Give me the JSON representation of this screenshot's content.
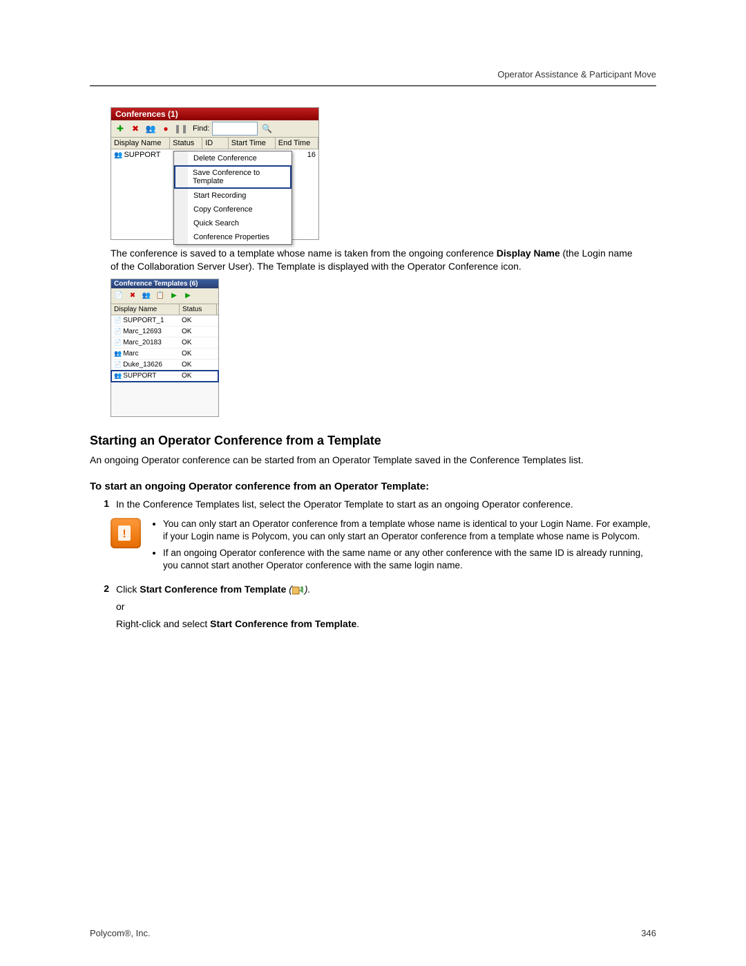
{
  "header": {
    "right": "Operator Assistance & Participant Move"
  },
  "conferences_panel": {
    "title": "Conferences (1)",
    "find_label": "Find:",
    "headers": {
      "display_name": "Display Name",
      "status": "Status",
      "id": "ID",
      "start_time": "Start Time",
      "end_time": "End Time"
    },
    "row": {
      "display_name": "SUPPORT",
      "end_time_partial": "16"
    },
    "context_menu": [
      "Delete Conference",
      "Save Conference to Template",
      "Start Recording",
      "Copy Conference",
      "Quick Search",
      "Conference Properties"
    ],
    "highlighted_index": 1
  },
  "para1_parts": {
    "a": "The conference is saved to a template whose name is taken from the ongoing conference ",
    "b": "Display Name",
    "c": " (the Login name of the Collaboration Server User). The Template is displayed with the Operator Conference icon."
  },
  "templates_panel": {
    "title": "Conference Templates (6)",
    "headers": {
      "display_name": "Display Name",
      "status": "Status"
    },
    "rows": [
      {
        "name": "SUPPORT_1",
        "status": "OK",
        "icon": "std"
      },
      {
        "name": "Marc_12693",
        "status": "OK",
        "icon": "std"
      },
      {
        "name": "Marc_20183",
        "status": "OK",
        "icon": "std"
      },
      {
        "name": "Marc",
        "status": "OK",
        "icon": "op"
      },
      {
        "name": "Duke_13626",
        "status": "OK",
        "icon": "std"
      },
      {
        "name": "SUPPORT",
        "status": "OK",
        "icon": "op"
      }
    ],
    "highlighted_index": 5
  },
  "section": {
    "h2": "Starting an Operator Conference from a Template",
    "intro": "An ongoing Operator conference can be started from an Operator Template saved in the Conference Templates list.",
    "h3": "To start an ongoing Operator conference from an Operator Template:",
    "step1": "In the Conference Templates list, select the Operator Template to start as an ongoing Operator conference.",
    "notes": [
      "You can only start an Operator conference from a template whose name is identical to your Login Name. For example, if your Login name is Polycom, you can only start an Operator conference from a template whose name is Polycom.",
      "If an ongoing Operator conference with the same name or any other conference with the same ID is already running, you cannot start another Operator conference with the same login name."
    ],
    "step2_prefix": "Click ",
    "step2_bold": "Start Conference from Template",
    "step2_paren_open": " (",
    "step2_paren_close": ").",
    "step2_or": "or",
    "step2_alt_a": "Right-click and select ",
    "step2_alt_b": "Start Conference from Template",
    "step2_alt_c": "."
  },
  "footer": {
    "left": "Polycom®, Inc.",
    "right": "346"
  }
}
